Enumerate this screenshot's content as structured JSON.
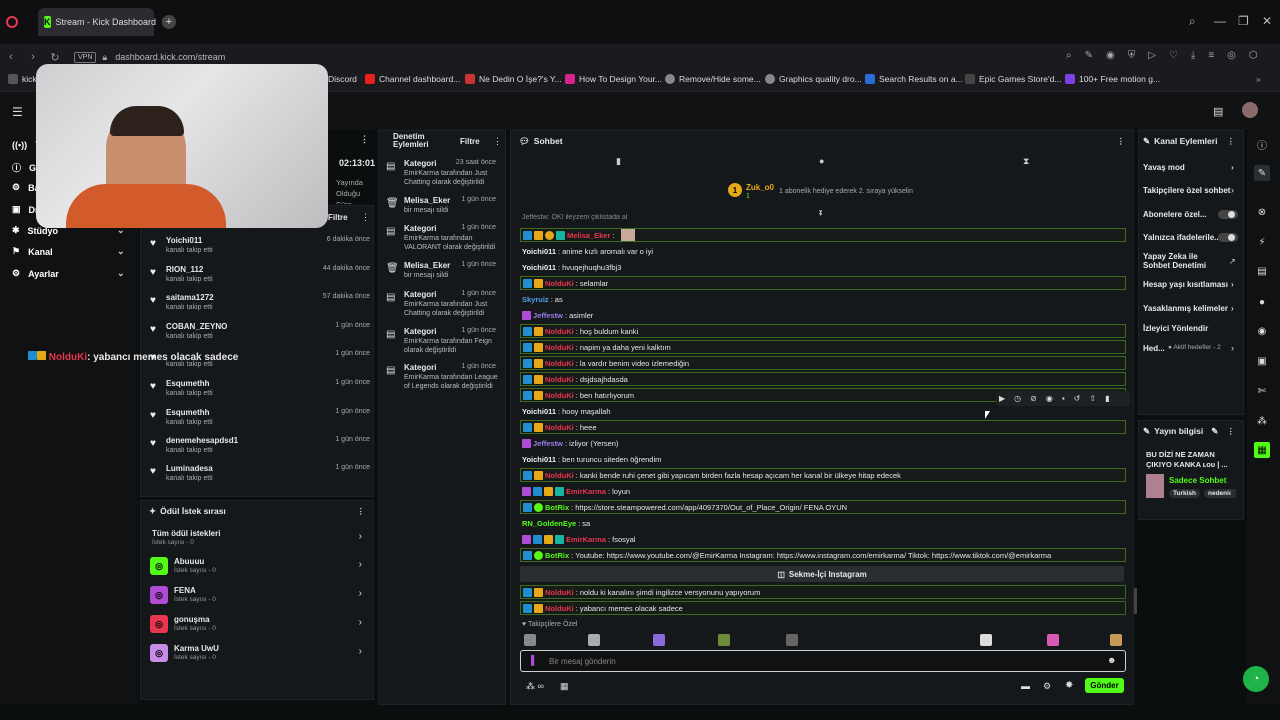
{
  "browser": {
    "tab_title": "Stream - Kick Dashboard",
    "url": "dashboard.kick.com/stream",
    "vpn_label": "VPN",
    "bookmarks": [
      "kick",
      "Discord",
      "Channel dashboard...",
      "Ne Dedin O İşe?'s Y...",
      "How To Design Your...",
      "Remove/Hide some...",
      "Graphics quality dro...",
      "Search Results on a...",
      "Epic Games Store'd...",
      "100+ Free motion g..."
    ]
  },
  "leftnav": {
    "items": [
      {
        "label": "Ya",
        "icon": "broadcast-icon"
      },
      {
        "label": "Ge",
        "icon": "info-icon"
      },
      {
        "label": "Ba",
        "icon": "settings-icon"
      },
      {
        "label": "Dr",
        "icon": "folder-icon"
      },
      {
        "label": "Stüdyo",
        "icon": "gear-icon"
      },
      {
        "label": "Kanal",
        "icon": "flag-icon"
      },
      {
        "label": "Ayarlar",
        "icon": "gear-icon"
      }
    ]
  },
  "overlay_chat": {
    "user": "NolduKi",
    "text": ": yabancı memes olacak sadece"
  },
  "stream_info": {
    "timer": "02:13:01",
    "status": "Yayında Olduğu Süre"
  },
  "followers": {
    "filter_label": "Filtre",
    "subtitle": "kanalı takip etti",
    "rows": [
      {
        "name": "Yoichi011",
        "time": "6 dakika önce"
      },
      {
        "name": "RION_112",
        "time": "44 dakika önce"
      },
      {
        "name": "saitama1272",
        "time": "57 dakika önce"
      },
      {
        "name": "COBAN_ZEYNO",
        "time": "1 gün önce"
      },
      {
        "name": "",
        "time": "1 gün önce"
      },
      {
        "name": "Esqumethh",
        "time": "1 gün önce"
      },
      {
        "name": "Esqumethh",
        "time": "1 gün önce"
      },
      {
        "name": "denemehesapdsd1",
        "time": "1 gün önce"
      },
      {
        "name": "Luminadesa",
        "time": "1 gün önce"
      }
    ]
  },
  "rewards": {
    "title": "Ödül İstek sırası",
    "all_label": "Tüm ödül istekleri",
    "all_count": "İstek sayısı - 0",
    "items": [
      {
        "name": "Abuuuu",
        "count": "İstek sayısı - 0",
        "color": "#53fc18"
      },
      {
        "name": "FENA",
        "count": "İstek sayısı - 0",
        "color": "#b04bd6"
      },
      {
        "name": "gonuşma",
        "count": "İstek sayısı - 0",
        "color": "#e8364f"
      },
      {
        "name": "Karma UwU",
        "count": "İstek sayısı - 0",
        "color": "#c58ce8"
      }
    ]
  },
  "moderation": {
    "title": "Denetim Eylemleri",
    "filter_label": "Filtre",
    "rows": [
      {
        "name": "Kategori",
        "time": "23 saat önce",
        "desc": "EmirKarma tarafından Just Chatting olarak değiştirildi",
        "icon": "category-icon"
      },
      {
        "name": "Melisa_Eker",
        "time": "1 gün önce",
        "desc": "bir mesajı sildi",
        "icon": "trash-icon"
      },
      {
        "name": "Kategori",
        "time": "1 gün önce",
        "desc": "EmirKarma tarafından VALORANT olarak değiştirildi",
        "icon": "category-icon"
      },
      {
        "name": "Melisa_Eker",
        "time": "1 gün önce",
        "desc": "bir mesajı sildi",
        "icon": "trash-icon"
      },
      {
        "name": "Kategori",
        "time": "1 gün önce",
        "desc": "EmirKarma tarafından Just Chatting olarak değiştirildi",
        "icon": "category-icon"
      },
      {
        "name": "Kategori",
        "time": "1 gün önce",
        "desc": "EmirKarma tarafından Feign olarak değiştirildi",
        "icon": "category-icon"
      },
      {
        "name": "Kategori",
        "time": "1 gün önce",
        "desc": "EmirKarma tarafından League of Legends olarak değiştirildi",
        "icon": "category-icon"
      }
    ]
  },
  "chat": {
    "title": "Sohbet",
    "pinned_user": "Zuk_o0",
    "pinned_count": "1",
    "pinned_text": "1 abonelik hediye ederek 2. sıraya yükselin",
    "top_partial": "Jeffestw: OK! ileyzem çiklistada al",
    "messages": [
      {
        "user": "Melisa_Eker",
        "text": "",
        "color": "#e8364f",
        "hl": true
      },
      {
        "user": "Yoichi011",
        "text": "anime kızlı aromalı var o iyi",
        "color": "#eee",
        "hl": false
      },
      {
        "user": "Yoichi011",
        "text": "hvuqejhuqhu3fbj3",
        "color": "#eee",
        "hl": false
      },
      {
        "user": "NolduKi",
        "text": "selamlar",
        "color": "#e8364f",
        "hl": true
      },
      {
        "user": "Skyruiz",
        "text": "as",
        "color": "#4fa3e8",
        "hl": false
      },
      {
        "user": "Jeffestw",
        "text": "asimler",
        "color": "#9b7be8",
        "hl": false
      },
      {
        "user": "NolduKi",
        "text": "hoş buldum kanki",
        "color": "#e8364f",
        "hl": true
      },
      {
        "user": "NolduKi",
        "text": "napim ya daha yeni kalktım",
        "color": "#e8364f",
        "hl": true
      },
      {
        "user": "NolduKi",
        "text": "la vardır benim video izlemediğin",
        "color": "#e8364f",
        "hl": true
      },
      {
        "user": "NolduKi",
        "text": "dsjdsajhdasda",
        "color": "#e8364f",
        "hl": true
      },
      {
        "user": "NolduKi",
        "text": "ben hatırlıyorum",
        "color": "#e8364f",
        "hl": true
      },
      {
        "user": "Yoichi011",
        "text": "hooy maşallah",
        "color": "#eee",
        "hl": false
      },
      {
        "user": "NolduKi",
        "text": "heee",
        "color": "#e8364f",
        "hl": true
      },
      {
        "user": "Jeffestw",
        "text": "izliyor (Yersen)",
        "color": "#9b7be8",
        "hl": false
      },
      {
        "user": "Yoichi011",
        "text": "ben turuncu siteden öğrendim",
        "color": "#eee",
        "hl": false
      },
      {
        "user": "NolduKi",
        "text": "kanki bende ruhi çenet gibi yapıcam birden fazla hesap açıcam her kanal bir ülkeye hitap edecek",
        "color": "#e8364f",
        "hl": true
      },
      {
        "user": "EmirKarma",
        "text": "loyun",
        "color": "#e8364f",
        "hl": false
      },
      {
        "user": "BotRix",
        "text": "https://store.steampowered.com/app/4097370/Out_of_Place_Origin/ FENA OYUN",
        "color": "#53fc18",
        "hl": true
      },
      {
        "user": "RN_GoldenEye",
        "text": "sa",
        "color": "#53fc18",
        "hl": false
      },
      {
        "user": "EmirKarma",
        "text": "fsosyal",
        "color": "#e8364f",
        "hl": false
      },
      {
        "user": "BotRix",
        "text": "Youtube: https://www.youtube.com/@EmirKarma Instagram: https://www.instagram.com/emirkarma/ Tiktok: https://www.tiktok.com/@emirkarma",
        "color": "#53fc18",
        "hl": true
      },
      {
        "user": "NolduKi",
        "text": "noldu ki kanalını şimdi ingilizce versyonunu yapıyorum",
        "color": "#e8364f",
        "hl": true
      },
      {
        "user": "NolduKi",
        "text": "yabancı memes olacak sadece",
        "color": "#e8364f",
        "hl": true
      }
    ],
    "instagram_button": "Sekme-İçi Instagram",
    "followers_only_label": "Takipçilere Özel",
    "input_placeholder": "Bir mesaj gönderin",
    "send_label": "Gönder"
  },
  "channel_actions": {
    "title": "Kanal Eylemleri",
    "items": [
      "Yavaş mod",
      "Takipçilere özel sohbet",
      "Abonelere özel...",
      "Yalnızca ifadelerile...",
      "Yapay Zeka ile Sohbet Denetimi",
      "Hesap yaşı kısıtlaması",
      "Yasaklanmış kelimeler",
      "İzleyici Yönlendir",
      "Hed..."
    ],
    "goal_tag": "Aktif hedefler - 2"
  },
  "stream_info_panel": {
    "title": "Yayın bilgisi",
    "stream_title": "BU DİZİ NE ZAMAN ÇIKIYO KANKA ʟᴏᴜ | ...",
    "category": "Sadece Sohbet",
    "tags": [
      "Turkish",
      "nedeniı"
    ]
  },
  "colors": {
    "accent": "#53fc18",
    "bg": "#0b0e0f",
    "panel": "#15181b"
  }
}
